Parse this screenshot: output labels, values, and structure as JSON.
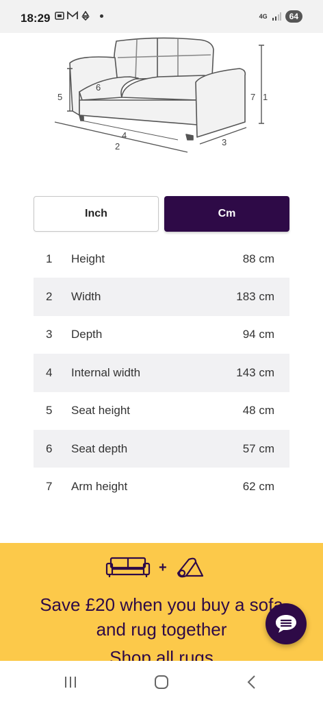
{
  "status_bar": {
    "time": "18:29",
    "network": "4G",
    "battery": "64"
  },
  "diagram": {
    "labels": [
      "5",
      "6",
      "4",
      "2",
      "3",
      "7",
      "1"
    ]
  },
  "unit_toggle": {
    "inch_label": "Inch",
    "cm_label": "Cm",
    "selected": "Cm",
    "selected_color": "#2e0a47"
  },
  "dimensions": [
    {
      "num": "1",
      "label": "Height",
      "value": "88 cm"
    },
    {
      "num": "2",
      "label": "Width",
      "value": "183 cm"
    },
    {
      "num": "3",
      "label": "Depth",
      "value": "94 cm"
    },
    {
      "num": "4",
      "label": "Internal width",
      "value": "143 cm"
    },
    {
      "num": "5",
      "label": "Seat height",
      "value": "48 cm"
    },
    {
      "num": "6",
      "label": "Seat depth",
      "value": "57 cm"
    },
    {
      "num": "7",
      "label": "Arm height",
      "value": "62 cm"
    }
  ],
  "promo": {
    "plus": "+",
    "line1": "Save £20 when you buy a sofa",
    "line2": "and rug together",
    "link": "Shop all rugs",
    "background": "#fcc94a"
  }
}
